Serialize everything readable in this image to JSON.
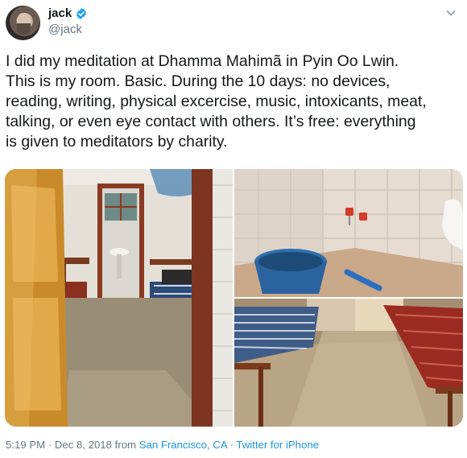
{
  "user": {
    "display_name": "jack",
    "handle": "@jack",
    "verified": true,
    "avatar_icon": "avatar-photo"
  },
  "tweet": {
    "lines": [
      "I did my meditation at Dhamma Mahimã in Pyin Oo Lwin.",
      "This is my room. Basic. During the 10 days: no devices,",
      "reading, writing, physical excercise, music, intoxicants, meat,",
      "talking, or even eye contact with others. It’s free: everything",
      "is given to meditators by charity."
    ]
  },
  "media": {
    "photos": [
      {
        "alt": "room-with-open-door-and-bed"
      },
      {
        "alt": "bathroom-with-blue-bucket"
      },
      {
        "alt": "room-with-two-beds"
      }
    ]
  },
  "meta": {
    "time": "5:19 PM",
    "sep1": " · ",
    "date": "Dec 8, 2018",
    "from": " from ",
    "location": "San Francisco, CA",
    "sep2": " · ",
    "source": "Twitter for iPhone"
  },
  "colors": {
    "link": "#1b95e0",
    "verified": "#1da1f2",
    "muted": "#657786",
    "text": "#14171a"
  }
}
